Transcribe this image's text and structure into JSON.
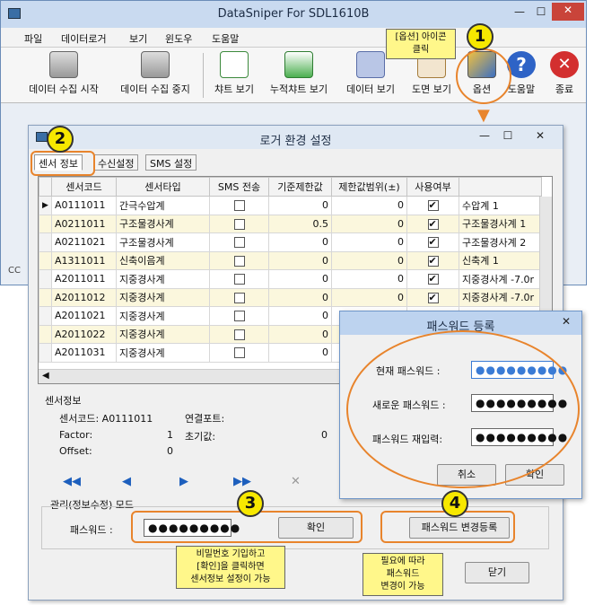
{
  "main": {
    "title": "DataSniper For SDL1610B",
    "menu": [
      "파일",
      "데이터로거",
      "보기",
      "윈도우",
      "도움말"
    ],
    "toolbar": [
      "데이터 수집 시작",
      "데이터 수집 중지",
      "챠트 보기",
      "누적챠트 보기",
      "데이터 보기",
      "도면 보기",
      "옵션",
      "도움말",
      "종료"
    ],
    "status_prefix": "CC"
  },
  "logger": {
    "title": "로거 환경 설정",
    "tabs": [
      "센서 정보",
      "수신설정",
      "SMS 설정"
    ],
    "columns": [
      "센서코드",
      "센서타입",
      "SMS 전송",
      "기준제한값",
      "제한값범위(±)",
      "사용여부",
      ""
    ],
    "rows": [
      {
        "code": "A0111011",
        "type": "간극수압계",
        "sms": false,
        "limit": "0",
        "range": "0",
        "use": true,
        "name": "수압계 1"
      },
      {
        "code": "A0211011",
        "type": "구조물경사계",
        "sms": false,
        "limit": "0.5",
        "range": "0",
        "use": true,
        "name": "구조물경사계 1"
      },
      {
        "code": "A0211021",
        "type": "구조물경사계",
        "sms": false,
        "limit": "0",
        "range": "0",
        "use": true,
        "name": "구조물경사계 2"
      },
      {
        "code": "A1311011",
        "type": "신축이음계",
        "sms": false,
        "limit": "0",
        "range": "0",
        "use": true,
        "name": "신축계 1"
      },
      {
        "code": "A2011011",
        "type": "지중경사계",
        "sms": false,
        "limit": "0",
        "range": "0",
        "use": true,
        "name": "지중경사계 -7.0r"
      },
      {
        "code": "A2011012",
        "type": "지중경사계",
        "sms": false,
        "limit": "0",
        "range": "0",
        "use": true,
        "name": "지중경사계 -7.0r"
      },
      {
        "code": "A2011021",
        "type": "지중경사계",
        "sms": false,
        "limit": "0",
        "range": "0",
        "use": true,
        "name": ""
      },
      {
        "code": "A2011022",
        "type": "지중경사계",
        "sms": false,
        "limit": "0",
        "range": "0",
        "use": true,
        "name": ""
      },
      {
        "code": "A2011031",
        "type": "지중경사계",
        "sms": false,
        "limit": "0",
        "range": "0",
        "use": true,
        "name": ""
      }
    ],
    "sensor_info": {
      "heading": "센서정보",
      "code_label": "센서코드: A0111011",
      "port_label": "연결포트:",
      "factor_label": "Factor:",
      "factor_value": "1",
      "init_label": "초기값:",
      "init_value": "0",
      "offset_label": "Offset:",
      "offset_value": "0"
    },
    "admin": {
      "heading": "관리(정보수정) 모드",
      "password_label": "패스워드 :",
      "password_value": "●●●●●●●●●",
      "confirm": "확인",
      "change_register": "패스워드 변경등록",
      "close": "닫기"
    }
  },
  "password_dialog": {
    "title": "패스워드 등록",
    "current_label": "현재 패스워드 :",
    "new_label": "새로운 패스워드 :",
    "retype_label": "패스워드 재입력:",
    "current_value": "●●●●●●●●●",
    "new_value": "●●●●●●●●●",
    "retype_value": "●●●●●●●●●",
    "cancel": "취소",
    "ok": "확인"
  },
  "annotations": {
    "badge1": "1",
    "badge2": "2",
    "badge3": "3",
    "badge4": "4",
    "callout1_line1": "[옵션] 아이콘",
    "callout1_line2": "클릭",
    "callout3_line1": "비밀번호 기입하고",
    "callout3_line2": "[확인]을 클릭하면",
    "callout3_line3": "센서정보 설정이 가능",
    "callout4_line1": "필요에 따라",
    "callout4_line2": "패스워드",
    "callout4_line3": "변경이 가능"
  },
  "colors": {
    "accent_orange": "#e8842c",
    "badge_yellow": "#f7e800",
    "row_alt": "#fbf7dd"
  }
}
